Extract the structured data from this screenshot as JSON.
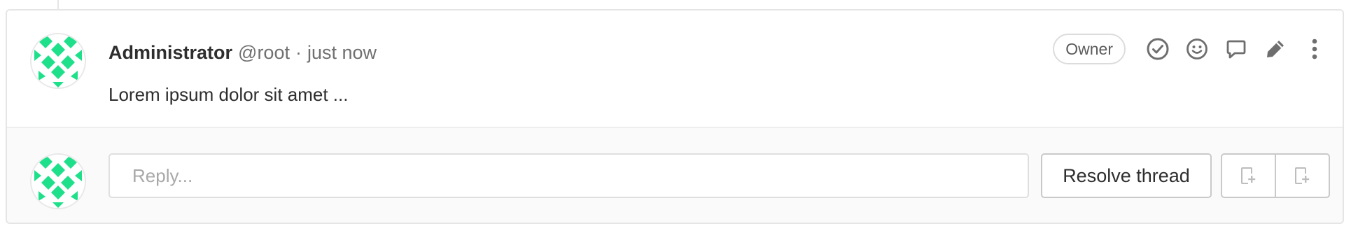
{
  "note": {
    "author": {
      "name": "Administrator",
      "username": "@root",
      "separator": "·",
      "time": "just now"
    },
    "body": "Lorem ipsum dolor sit amet ...",
    "role_badge": "Owner",
    "actions": [
      {
        "name": "resolve-thread-icon",
        "label": "Resolve thread"
      },
      {
        "name": "emoji-icon",
        "label": "Add reaction"
      },
      {
        "name": "reply-icon",
        "label": "Reply to comment"
      },
      {
        "name": "edit-icon",
        "label": "Edit comment"
      },
      {
        "name": "more-actions-icon",
        "label": "More actions"
      }
    ]
  },
  "reply": {
    "placeholder": "Reply...",
    "resolve_label": "Resolve thread",
    "group_buttons": [
      {
        "name": "create-issue-icon"
      },
      {
        "name": "create-issue-icon"
      }
    ]
  },
  "colors": {
    "avatar_accent": "#1ee08b",
    "text_primary": "#2e2e2e",
    "text_secondary": "#707070",
    "icon": "#6e6e6e",
    "border": "#e5e5e5"
  }
}
